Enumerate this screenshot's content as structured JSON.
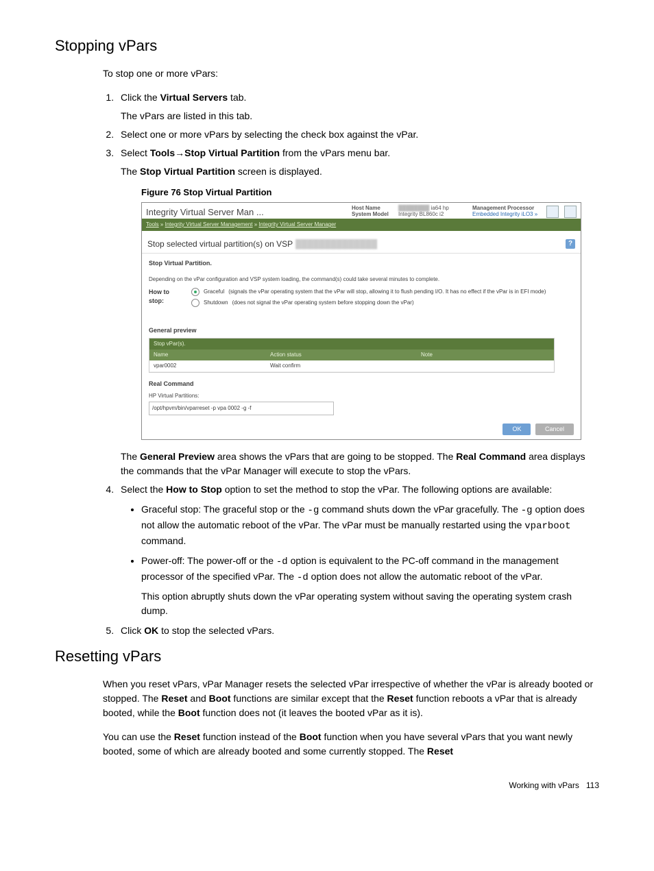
{
  "section1": {
    "title": "Stopping vPars",
    "intro": "To stop one or more vPars:",
    "step1_a": "Click the ",
    "step1_b": "Virtual Servers",
    "step1_c": " tab.",
    "step1_sub": "The vPars are listed in this tab.",
    "step2": "Select one or more vPars by selecting the check box against the vPar.",
    "step3_a": "Select ",
    "step3_b": "Tools",
    "step3_arrow": "→",
    "step3_c": "Stop Virtual Partition",
    "step3_d": " from the vPars menu bar.",
    "step3_sub_a": "The ",
    "step3_sub_b": "Stop Virtual Partition",
    "step3_sub_c": " screen is displayed.",
    "figure_caption": "Figure 76 Stop Virtual Partition",
    "post_fig_a": "The ",
    "post_fig_b": "General Preview",
    "post_fig_c": " area shows the vPars that are going to be stopped. The ",
    "post_fig_d": "Real Command",
    "post_fig_e": " area displays the commands that the vPar Manager will execute to stop the vPars.",
    "step4_a": "Select the ",
    "step4_b": "How to Stop",
    "step4_c": " option to set the method to stop the vPar. The following options are available:",
    "bullet1_a": "Graceful stop: The graceful stop or the ",
    "bullet1_code1": "-g",
    "bullet1_b": " command shuts down the vPar gracefully. The ",
    "bullet1_code2": "-g",
    "bullet1_c": " option does not allow the automatic reboot of the vPar. The vPar must be manually restarted using the ",
    "bullet1_code3": "vparboot",
    "bullet1_d": " command.",
    "bullet2_a": "Power-off: The power-off or the ",
    "bullet2_code1": "-d",
    "bullet2_b": " option is equivalent to the PC-off command in the management processor of the specified vPar. The ",
    "bullet2_code2": "-d",
    "bullet2_c": " option does not allow the automatic reboot of the vPar.",
    "bullet2_sub": "This option abruptly shuts down the vPar operating system without saving the operating system crash dump.",
    "step5_a": "Click ",
    "step5_b": "OK",
    "step5_c": " to stop the selected vPars."
  },
  "section2": {
    "title": "Resetting vPars",
    "p1_a": "When you reset vPars, vPar Manager resets the selected vPar irrespective of whether the vPar is already booted or stopped. The ",
    "p1_b": "Reset",
    "p1_c": " and ",
    "p1_d": "Boot",
    "p1_e": " functions are similar except that the ",
    "p1_f": "Reset",
    "p1_g": " function reboots a vPar that is already booted, while the ",
    "p1_h": "Boot",
    "p1_i": " function does not (it leaves the booted vPar as it is).",
    "p2_a": "You can use the ",
    "p2_b": "Reset",
    "p2_c": " function instead of the ",
    "p2_d": "Boot",
    "p2_e": " function when you have several vPars that you want newly booted, some of which are already booted and some currently stopped. The ",
    "p2_f": "Reset"
  },
  "screenshot": {
    "app_title": "Integrity Virtual Server Man ...",
    "hostname_lbl": "Host Name",
    "sysmodel_lbl": "System Model",
    "sysmodel_val": "ia64 hp Integrity BL860c i2",
    "mgmt_lbl": "Management Processor",
    "mgmt_val": "Embedded Integrity iLO3  »",
    "breadcrumb_1": "Tools",
    "breadcrumb_2": "Integrity Virtual Server Management",
    "breadcrumb_3": "Integrity Virtual Server Manager",
    "subtitle": "Stop selected virtual partition(s) on VSP",
    "panel_title": "Stop Virtual Partition.",
    "panel_desc": "Depending on the vPar configuration and VSP system loading, the command(s) could take several minutes to complete.",
    "how_lbl": "How to stop:",
    "opt1_name": "Graceful",
    "opt1_desc": "(signals the vPar operating system that the vPar will stop, allowing it to flush pending I/O. It has no effect if the vPar is in EFI mode)",
    "opt2_name": "Shutdown",
    "opt2_desc": "(does not signal the vPar operating system before stopping down the vPar)",
    "preview_title": "General preview",
    "tbl_caption": "Stop vPar(s).",
    "col_name": "Name",
    "col_action": "Action status",
    "col_note": "Note",
    "row_name": "vpar0002",
    "row_action": "Wait confirm",
    "real_cmd_title": "Real Command",
    "real_cmd_sub": "HP Virtual Partitions:",
    "real_cmd_val": "/opt/hpvm/bin/vparreset -p vpa 0002 -g -f",
    "btn_ok": "OK",
    "btn_cancel": "Cancel"
  },
  "footer": {
    "text": "Working with vPars",
    "page": "113"
  }
}
